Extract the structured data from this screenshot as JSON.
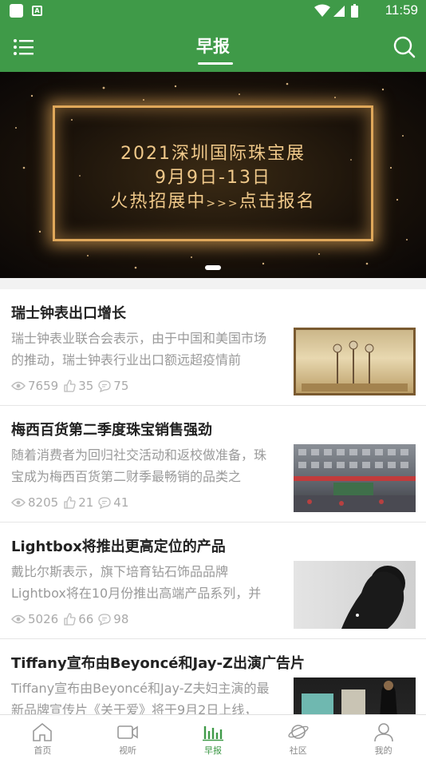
{
  "status": {
    "time": "11:59"
  },
  "header": {
    "title": "早报"
  },
  "banner": {
    "line1": "2021深圳国际珠宝展",
    "line2": "9月9日-13日",
    "line3_a": "火热招展中",
    "line3_b": ">>>",
    "line3_c": "点击报名"
  },
  "news": [
    {
      "title": "瑞士钟表出口增长",
      "summary": "瑞士钟表业联合会表示，由于中国和美国市场的推动，瑞士钟表行业出口额远超疫情前",
      "views": "7659",
      "likes": "35",
      "comments": "75"
    },
    {
      "title": "梅西百货第二季度珠宝销售强劲",
      "summary": "随着消费者为回归社交活动和返校做准备，珠宝成为梅西百货第二财季最畅销的品类之",
      "views": "8205",
      "likes": "21",
      "comments": "41"
    },
    {
      "title": "Lightbox将推出更高定位的产品",
      "summary": "戴比尔斯表示，旗下培育钻石饰品品牌Lightbox将在10月份推出高端产品系列，并",
      "views": "5026",
      "likes": "66",
      "comments": "98"
    },
    {
      "title": "Tiffany宣布由Beyoncé和Jay-Z出演广告片",
      "summary": "Tiffany宣布由Beyoncé和Jay-Z夫妇主演的最新品牌宣传片《关于爱》将于9月2日上线，",
      "views": "",
      "likes": "",
      "comments": ""
    }
  ],
  "tabs": [
    {
      "label": "首页",
      "icon": "home-icon"
    },
    {
      "label": "视听",
      "icon": "video-icon"
    },
    {
      "label": "早报",
      "icon": "chart-icon"
    },
    {
      "label": "社区",
      "icon": "planet-icon"
    },
    {
      "label": "我的",
      "icon": "user-icon"
    }
  ],
  "colors": {
    "accent": "#3f9a48"
  }
}
